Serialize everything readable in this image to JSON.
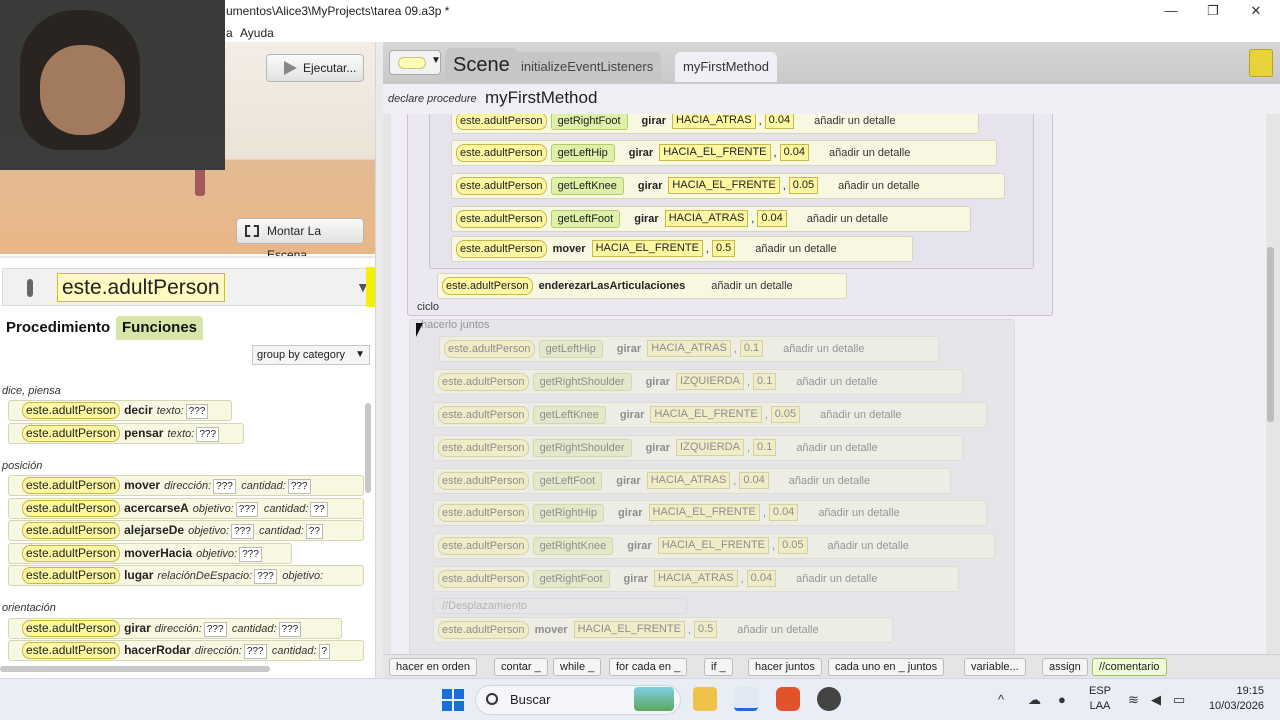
{
  "window": {
    "title": "umentos\\Alice3\\MyProjects\\tarea 09.a3p *",
    "minimize": "—",
    "restore": "❐",
    "close": "✕"
  },
  "menubar": {
    "items": [
      "a",
      "Ayuda"
    ]
  },
  "scene_controls": {
    "run_label": "Ejecutar...",
    "setup_label": "Montar La Escena"
  },
  "instance_selector": {
    "value": "este.adultPerson"
  },
  "left_tabs": {
    "procedures": "Procedimiento",
    "functions": "Funciones"
  },
  "group_by": "group by category",
  "categories": [
    {
      "label": "dice, piensa"
    },
    {
      "label": "posición"
    },
    {
      "label": "orientación"
    }
  ],
  "procedures": [
    {
      "inst": "este.adultPerson",
      "verb": "decir",
      "arg1": "texto:",
      "q1": "???"
    },
    {
      "inst": "este.adultPerson",
      "verb": "pensar",
      "arg1": "texto:",
      "q1": "???"
    },
    {
      "inst": "este.adultPerson",
      "verb": "mover",
      "arg1": "dirección:",
      "q1": "???",
      "arg2": "cantidad:",
      "q2": "???"
    },
    {
      "inst": "este.adultPerson",
      "verb": "acercarseA",
      "arg1": "objetivo:",
      "q1": "???",
      "arg2": "cantidad:",
      "q2": "??"
    },
    {
      "inst": "este.adultPerson",
      "verb": "alejarseDe",
      "arg1": "objetivo:",
      "q1": "???",
      "arg2": "cantidad:",
      "q2": "??"
    },
    {
      "inst": "este.adultPerson",
      "verb": "moverHacia",
      "arg1": "objetivo:",
      "q1": "???"
    },
    {
      "inst": "este.adultPerson",
      "verb": "lugar",
      "arg1": "relaciónDeEspacio:",
      "q1": "???",
      "arg2": "objetivo:",
      "q2": ""
    },
    {
      "inst": "este.adultPerson",
      "verb": "girar",
      "arg1": "dirección:",
      "q1": "???",
      "arg2": "cantidad:",
      "q2": "???"
    },
    {
      "inst": "este.adultPerson",
      "verb": "hacerRodar",
      "arg1": "dirección:",
      "q1": "???",
      "arg2": "cantidad:",
      "q2": "?"
    }
  ],
  "editor": {
    "tabs": {
      "scene": "Scene",
      "init": "initializeEventListeners",
      "method": "myFirstMethod"
    },
    "declare_label": "declare procedure",
    "method_name": "myFirstMethod",
    "detail_label": "añadir un detalle",
    "cycle_label": "ciclo",
    "together_label": "hacerlo juntos",
    "comment_text": "//Desplazamiento",
    "statements_top": [
      {
        "inst": "este.adultPerson",
        "joint": "getRightFoot",
        "verb": "girar",
        "dir": "HACIA_ATRAS",
        "amount": "0.04"
      },
      {
        "inst": "este.adultPerson",
        "joint": "getLeftHip",
        "verb": "girar",
        "dir": "HACIA_EL_FRENTE",
        "amount": "0.04"
      },
      {
        "inst": "este.adultPerson",
        "joint": "getLeftKnee",
        "verb": "girar",
        "dir": "HACIA_EL_FRENTE",
        "amount": "0.05"
      },
      {
        "inst": "este.adultPerson",
        "joint": "getLeftFoot",
        "verb": "girar",
        "dir": "HACIA_ATRAS",
        "amount": "0.04"
      },
      {
        "inst": "este.adultPerson",
        "joint": "",
        "verb": "mover",
        "dir": "HACIA_EL_FRENTE",
        "amount": "0.5"
      }
    ],
    "straighten": {
      "inst": "este.adultPerson",
      "verb": "enderezarLasArticulaciones"
    },
    "statements_bottom": [
      {
        "inst": "este.adultPerson",
        "joint": "getLeftHip",
        "verb": "girar",
        "dir": "HACIA_ATRAS",
        "amount": "0.1"
      },
      {
        "inst": "este.adultPerson",
        "joint": "getRightShoulder",
        "verb": "girar",
        "dir": "IZQUIERDA",
        "amount": "0.1"
      },
      {
        "inst": "este.adultPerson",
        "joint": "getLeftKnee",
        "verb": "girar",
        "dir": "HACIA_EL_FRENTE",
        "amount": "0.05"
      },
      {
        "inst": "este.adultPerson",
        "joint": "getRightShoulder",
        "verb": "girar",
        "dir": "IZQUIERDA",
        "amount": "0.1"
      },
      {
        "inst": "este.adultPerson",
        "joint": "getLeftFoot",
        "verb": "girar",
        "dir": "HACIA_ATRAS",
        "amount": "0.04"
      },
      {
        "inst": "este.adultPerson",
        "joint": "getRightHip",
        "verb": "girar",
        "dir": "HACIA_EL_FRENTE",
        "amount": "0.04"
      },
      {
        "inst": "este.adultPerson",
        "joint": "getRightKnee",
        "verb": "girar",
        "dir": "HACIA_EL_FRENTE",
        "amount": "0.05"
      },
      {
        "inst": "este.adultPerson",
        "joint": "getRightFoot",
        "verb": "girar",
        "dir": "HACIA_ATRAS",
        "amount": "0.04"
      }
    ],
    "final_move": {
      "inst": "este.adultPerson",
      "verb": "mover",
      "dir": "HACIA_EL_FRENTE",
      "amount": "0.5"
    }
  },
  "toolbar": {
    "do_in_order": "hacer en orden",
    "count": "contar _",
    "while": "while _",
    "for_each": "for cada en _",
    "if": "if _",
    "do_together": "hacer juntos",
    "each_together": "cada uno en _ juntos",
    "variable": "variable...",
    "assign": "assign",
    "comment": "//comentario"
  },
  "taskbar": {
    "search_placeholder": "Buscar",
    "lang_line1": "ESP",
    "lang_line2": "LAA",
    "time": "19:15",
    "date": "10/03/2026"
  },
  "colors": {
    "instance_tile": "#fcf7a0",
    "joint_tile": "#dff0a8",
    "editor_bg": "#f1eef5",
    "functions_tab": "#d7e6a8"
  }
}
